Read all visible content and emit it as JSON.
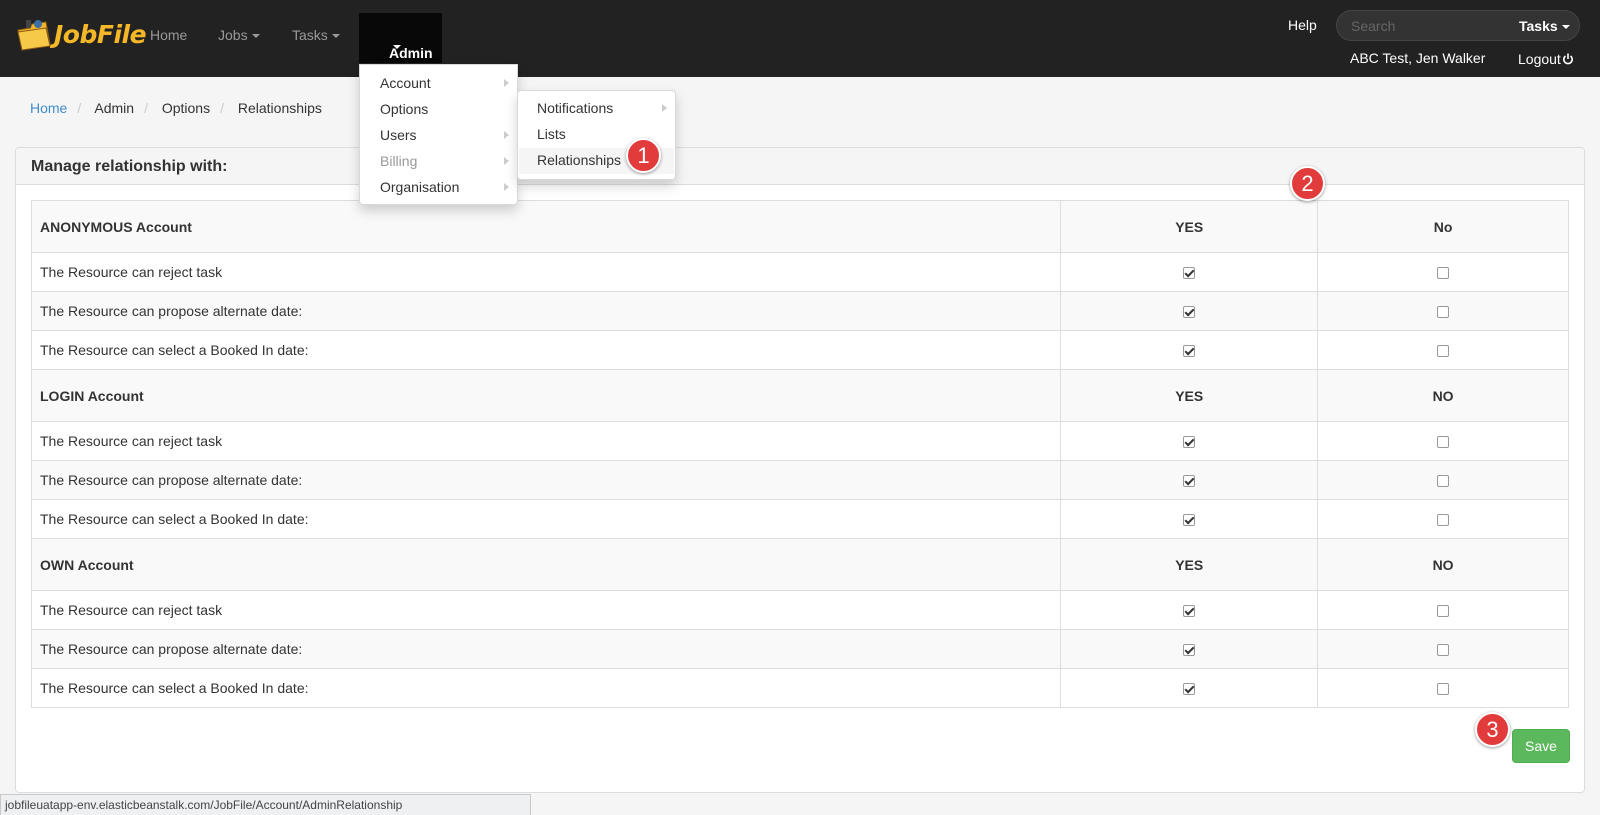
{
  "app": {
    "logo_text": "JobFile"
  },
  "nav": {
    "home": "Home",
    "jobs": "Jobs",
    "tasks": "Tasks",
    "admin": "Admin",
    "help": "Help",
    "search_placeholder": "Search",
    "search_button": "Tasks",
    "user": "ABC Test, Jen Walker",
    "logout": "Logout"
  },
  "admin_menu": [
    {
      "label": "Account",
      "has_submenu": true,
      "disabled": false
    },
    {
      "label": "Options",
      "has_submenu": false,
      "disabled": false
    },
    {
      "label": "Users",
      "has_submenu": true,
      "disabled": false
    },
    {
      "label": "Billing",
      "has_submenu": true,
      "disabled": true
    },
    {
      "label": "Organisation",
      "has_submenu": true,
      "disabled": false
    }
  ],
  "options_menu": [
    {
      "label": "Notifications",
      "has_submenu": true
    },
    {
      "label": "Lists",
      "has_submenu": false
    },
    {
      "label": "Relationships",
      "has_submenu": false,
      "highlighted": true
    }
  ],
  "breadcrumb": [
    "Home",
    "Admin",
    "Options",
    "Relationships"
  ],
  "panel": {
    "title": "Manage relationship with:"
  },
  "sections": [
    {
      "name": "ANONYMOUS Account",
      "yes_label": "YES",
      "no_label": "No",
      "rows": [
        {
          "label": "The Resource can reject task",
          "yes": true,
          "no": false
        },
        {
          "label": "The Resource can propose alternate date:",
          "yes": true,
          "no": false
        },
        {
          "label": "The Resource can select a Booked In date:",
          "yes": true,
          "no": false
        }
      ]
    },
    {
      "name": "LOGIN Account",
      "yes_label": "YES",
      "no_label": "NO",
      "rows": [
        {
          "label": "The Resource can reject task",
          "yes": true,
          "no": false
        },
        {
          "label": "The Resource can propose alternate date:",
          "yes": true,
          "no": false
        },
        {
          "label": "The Resource can select a Booked In date:",
          "yes": true,
          "no": false
        }
      ]
    },
    {
      "name": "OWN Account",
      "yes_label": "YES",
      "no_label": "NO",
      "rows": [
        {
          "label": "The Resource can reject task",
          "yes": true,
          "no": false
        },
        {
          "label": "The Resource can propose alternate date:",
          "yes": true,
          "no": false
        },
        {
          "label": "The Resource can select a Booked In date:",
          "yes": true,
          "no": false
        }
      ]
    }
  ],
  "save_label": "Save",
  "markers": [
    "1",
    "2",
    "3"
  ],
  "status_url": "jobfileuatapp-env.elasticbeanstalk.com/JobFile/Account/AdminRelationship",
  "colors": {
    "navbar": "#222222",
    "link": "#428bca",
    "save": "#5cb85c",
    "marker": "#e23b3b"
  }
}
